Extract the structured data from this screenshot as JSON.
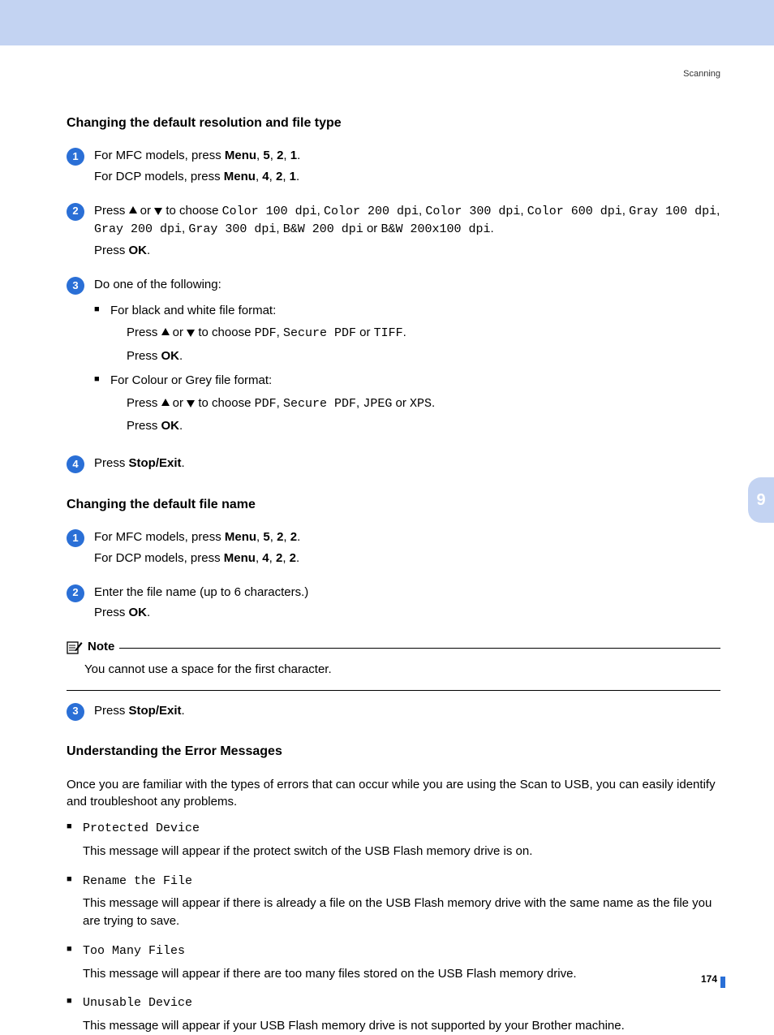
{
  "header_label": "Scanning",
  "side_tab": "9",
  "page_number": "174",
  "s1": {
    "title": "Changing the default resolution and file type",
    "step1a": "For MFC models, press ",
    "step1a_menu": "Menu",
    "step1a_rest": ", ",
    "step1a_k1": "5",
    "step1a_k2": "2",
    "step1a_k3": "1",
    "step1b": "For DCP models, press ",
    "step1b_menu": "Menu",
    "step1b_k1": "4",
    "step1b_k2": "2",
    "step1b_k3": "1",
    "step2_press": "Press ",
    "step2_or": " or ",
    "step2_tochoose": " to choose ",
    "opts": {
      "c100": "Color 100 dpi",
      "c200": "Color 200 dpi",
      "c300": "Color 300 dpi",
      "c600": "Color 600 dpi",
      "g100": "Gray 100 dpi",
      "g200": "Gray 200 dpi",
      "g300": "Gray 300 dpi",
      "bw200": "B&W 200 dpi",
      "bw200x100": "B&W 200x100 dpi"
    },
    "step2_or_word": " or ",
    "step2_press_ok_pre": "Press ",
    "ok": "OK",
    "step3_intro": "Do one of the following:",
    "step3_bw": "For black and white file format:",
    "step3_press": "Press ",
    "step3_or": " or ",
    "step3_tochoose": " to choose ",
    "fmt": {
      "pdf": "PDF",
      "spdf": "Secure PDF",
      "tiff": "TIFF",
      "jpeg": "JPEG",
      "xps": "XPS"
    },
    "step3_color": "For Colour or Grey file format:",
    "step4_press": "Press ",
    "stop_exit": "Stop/Exit"
  },
  "s2": {
    "title": "Changing the default file name",
    "step1a": "For MFC models, press ",
    "menu": "Menu",
    "s2_k1": "5",
    "s2_k2": "2",
    "s2_k3": "2",
    "step1b": "For DCP models, press ",
    "s2b_k1": "4",
    "s2b_k2": "2",
    "s2b_k3": "2",
    "step2": "Enter the file name (up to 6 characters.)",
    "press": "Press ",
    "ok": "OK",
    "note_title": "Note",
    "note_body": "You cannot use a space for the first character.",
    "step3_press": "Press ",
    "stop_exit": "Stop/Exit"
  },
  "s3": {
    "title": "Understanding the Error Messages",
    "intro": "Once you are familiar with the types of errors that can occur while you are using the Scan to USB, you can easily identify and troubleshoot any problems.",
    "e1": "Protected Device",
    "e1d": "This message will appear if the protect switch of the USB Flash memory drive is on.",
    "e2": "Rename the File",
    "e2d": "This message will appear if there is already a file on the USB Flash memory drive with the same name as the file you are trying to save.",
    "e3": "Too Many Files",
    "e3d": "This message will appear if there are too many files stored on the USB Flash memory drive.",
    "e4": "Unusable Device",
    "e4d": "This message will appear if your USB Flash memory drive is not supported by your Brother machine."
  }
}
